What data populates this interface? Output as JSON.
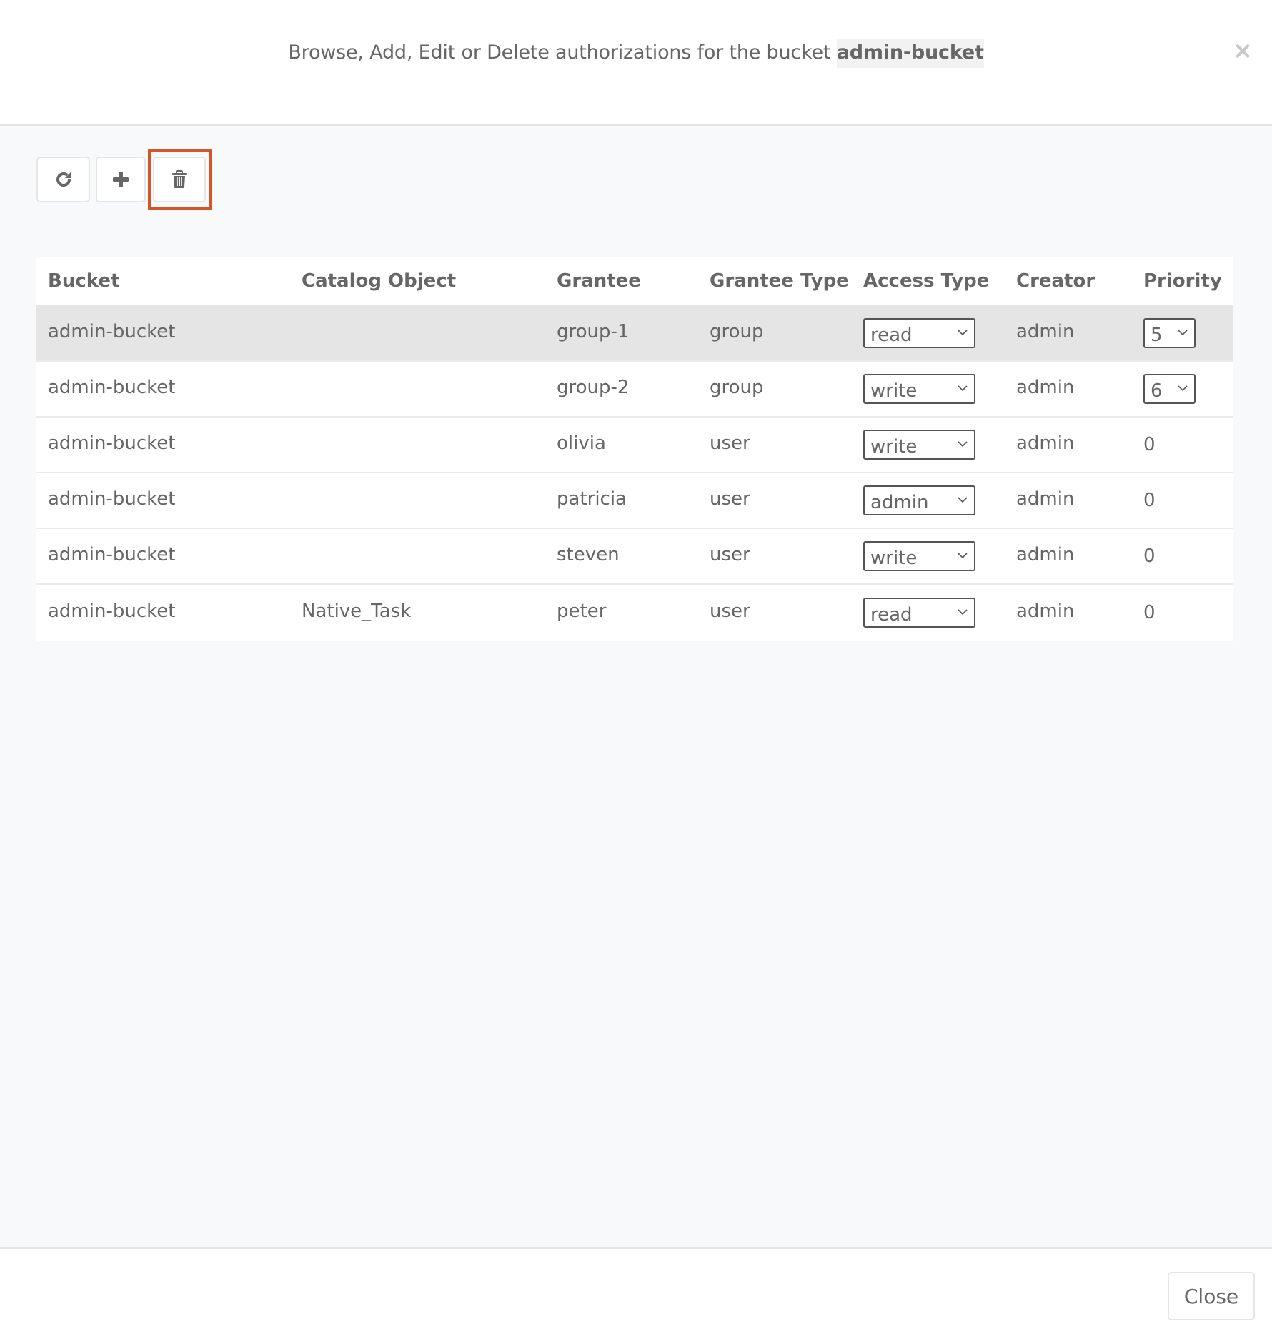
{
  "header": {
    "title_prefix": "Browse, Add, Edit or Delete authorizations for the bucket ",
    "bucket_name": "admin-bucket",
    "close_icon": "×"
  },
  "toolbar": {
    "buttons": [
      {
        "name": "refresh",
        "icon": "refresh-icon"
      },
      {
        "name": "add",
        "icon": "plus-icon"
      },
      {
        "name": "delete",
        "icon": "trash-icon",
        "highlighted": true
      }
    ],
    "highlight_color": "#d35628"
  },
  "table": {
    "columns": [
      "Bucket",
      "Catalog Object",
      "Grantee",
      "Grantee Type",
      "Access Type",
      "Creator",
      "Priority"
    ],
    "rows": [
      {
        "bucket": "admin-bucket",
        "catalog_object": "",
        "grantee": "group-1",
        "grantee_type": "group",
        "access_type": "read",
        "creator": "admin",
        "priority": "5",
        "priority_editable": true,
        "selected": true
      },
      {
        "bucket": "admin-bucket",
        "catalog_object": "",
        "grantee": "group-2",
        "grantee_type": "group",
        "access_type": "write",
        "creator": "admin",
        "priority": "6",
        "priority_editable": true,
        "selected": false
      },
      {
        "bucket": "admin-bucket",
        "catalog_object": "",
        "grantee": "olivia",
        "grantee_type": "user",
        "access_type": "write",
        "creator": "admin",
        "priority": "0",
        "priority_editable": false,
        "selected": false
      },
      {
        "bucket": "admin-bucket",
        "catalog_object": "",
        "grantee": "patricia",
        "grantee_type": "user",
        "access_type": "admin",
        "creator": "admin",
        "priority": "0",
        "priority_editable": false,
        "selected": false
      },
      {
        "bucket": "admin-bucket",
        "catalog_object": "",
        "grantee": "steven",
        "grantee_type": "user",
        "access_type": "write",
        "creator": "admin",
        "priority": "0",
        "priority_editable": false,
        "selected": false
      },
      {
        "bucket": "admin-bucket",
        "catalog_object": "Native_Task",
        "grantee": "peter",
        "grantee_type": "user",
        "access_type": "read",
        "creator": "admin",
        "priority": "0",
        "priority_editable": false,
        "selected": false
      }
    ]
  },
  "footer": {
    "close_label": "Close"
  }
}
